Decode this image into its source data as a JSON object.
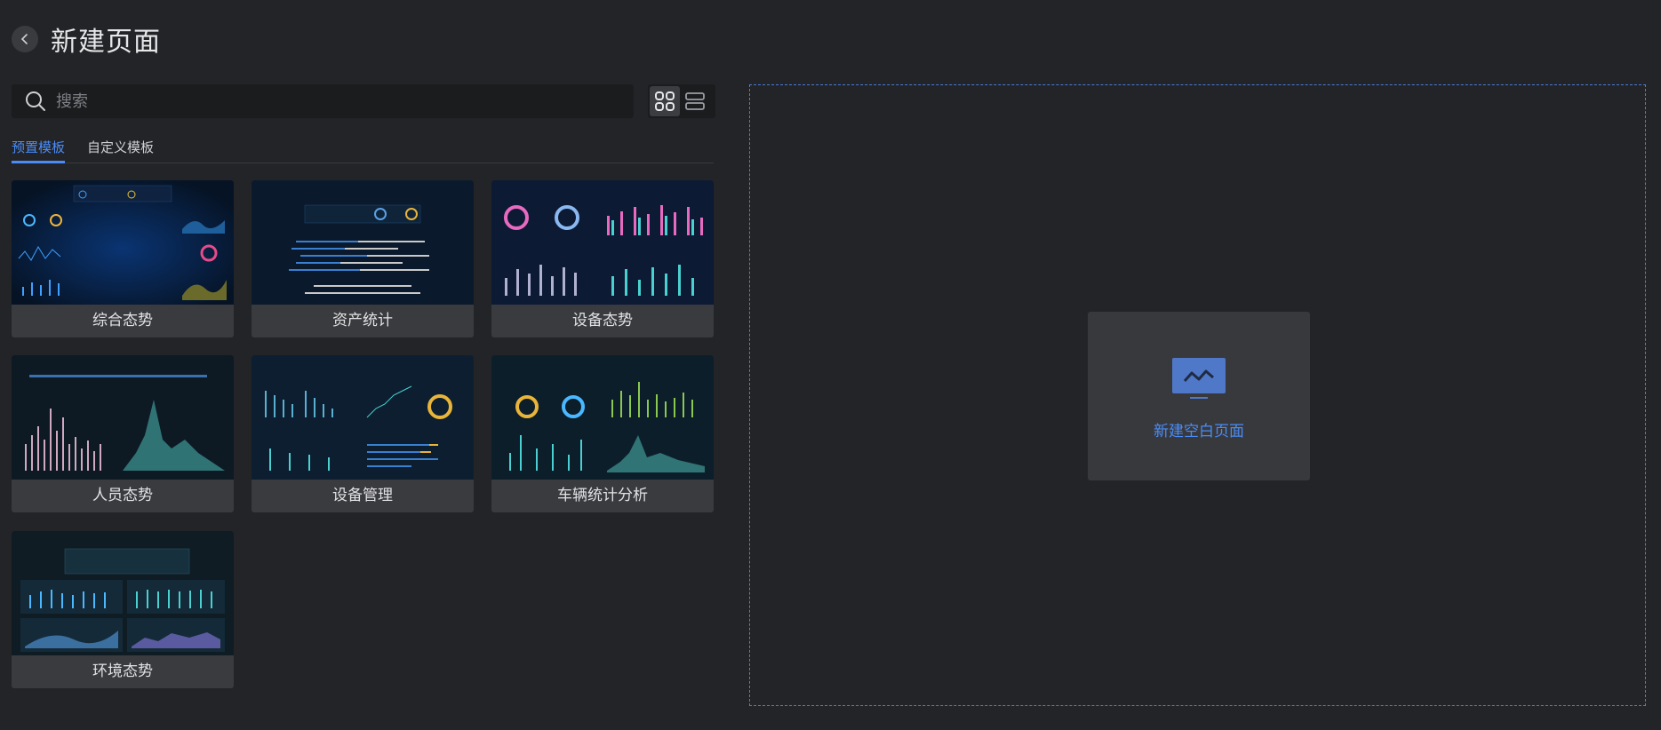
{
  "header": {
    "title": "新建页面"
  },
  "search": {
    "placeholder": "搜索"
  },
  "tabs": [
    {
      "label": "预置模板",
      "active": true
    },
    {
      "label": "自定义模板",
      "active": false
    }
  ],
  "templates": [
    {
      "label": "综合态势"
    },
    {
      "label": "资产统计"
    },
    {
      "label": "设备态势"
    },
    {
      "label": "人员态势"
    },
    {
      "label": "设备管理"
    },
    {
      "label": "车辆统计分析"
    },
    {
      "label": "环境态势"
    }
  ],
  "blank_page": {
    "label": "新建空白页面"
  },
  "colors": {
    "accent": "#4a8cf7",
    "background": "#232427",
    "card": "#3a3b3f"
  },
  "icons": [
    "back-icon",
    "search-icon",
    "grid-view-icon",
    "list-view-icon",
    "blank-page-icon"
  ]
}
